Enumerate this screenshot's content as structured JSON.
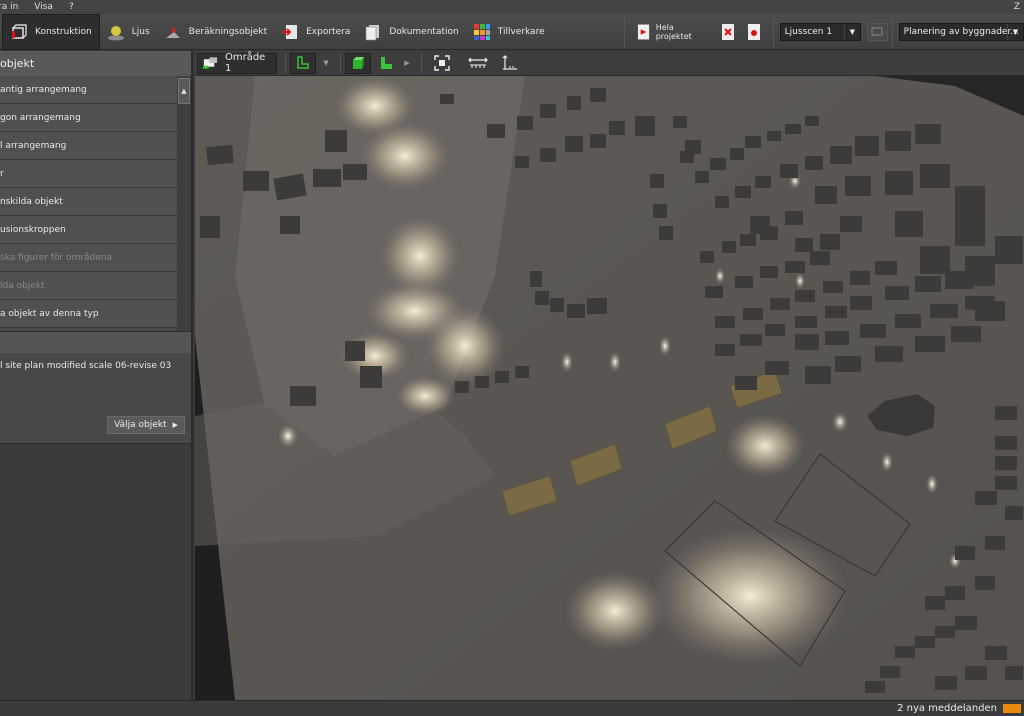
{
  "menu": {
    "items": [
      "ra in",
      "Visa",
      "?"
    ],
    "right": "Z"
  },
  "ribbon": {
    "tabs": [
      {
        "label": "Konstruktion",
        "icon": "construction-box-icon",
        "active": true
      },
      {
        "label": "Ljus",
        "icon": "lamp-icon"
      },
      {
        "label": "Beräkningsobjekt",
        "icon": "calc-object-icon"
      },
      {
        "label": "Exportera",
        "icon": "export-arrow-icon"
      },
      {
        "label": "Dokumentation",
        "icon": "document-icon"
      },
      {
        "label": "Tillverkare",
        "icon": "manufacturer-grid-icon"
      }
    ],
    "hela_projektet": "Hela projektet",
    "scene_select": "Ljusscen 1",
    "planning_select": "Planering av byggnader..."
  },
  "left_panel": {
    "title": "objekt",
    "items": [
      {
        "label": "antig arrangemang",
        "disabled": false
      },
      {
        "label": "gon arrangemang",
        "disabled": false
      },
      {
        "label": "l arrangemang",
        "disabled": false
      },
      {
        "label": "r",
        "disabled": false
      },
      {
        "label": "nskilda objekt",
        "disabled": false
      },
      {
        "label": "usionskroppen",
        "disabled": false
      },
      {
        "label": "ska figurer för områdena",
        "disabled": true
      },
      {
        "label": "lda objekt",
        "disabled": true
      },
      {
        "label": "a objekt av denna typ",
        "disabled": false
      }
    ],
    "info_text": "l site plan modified scale 06-revise 03",
    "select_button": "Välja objekt"
  },
  "view_toolbar": {
    "area_label": "Område 1"
  },
  "status": {
    "messages": "2 nya meddelanden"
  },
  "colors": {
    "accent_orange": "#e88a10",
    "highlight_green": "#3fc23f"
  }
}
